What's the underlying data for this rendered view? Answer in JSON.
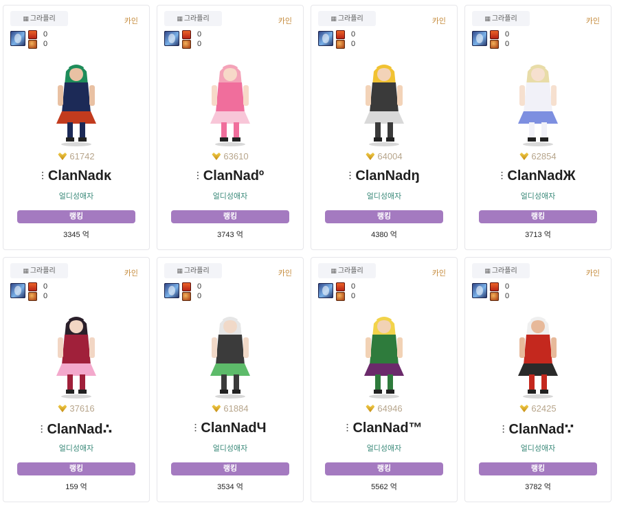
{
  "cards": [
    {
      "server": "그라플리",
      "job": "카인",
      "stat_a": "0",
      "stat_b": "0",
      "score": "61742",
      "name": "ClanNadĸ",
      "guild": "얼디성애자",
      "rank_label": "랭킹",
      "fame": "3345 억",
      "palette": {
        "hair": "#1e8c5a",
        "body": "#1c2a57",
        "accent": "#c23b1e",
        "skin": "#e9c1a3"
      }
    },
    {
      "server": "그라플리",
      "job": "카인",
      "stat_a": "0",
      "stat_b": "0",
      "score": "63610",
      "name": "ClanNadº",
      "guild": "얼디성애자",
      "rank_label": "랭킹",
      "fame": "3743 억",
      "palette": {
        "hair": "#f4a3b8",
        "body": "#f06e9c",
        "accent": "#f8c6d8",
        "skin": "#f7d9c8"
      }
    },
    {
      "server": "그라플리",
      "job": "카인",
      "stat_a": "0",
      "stat_b": "0",
      "score": "64004",
      "name": "ClanNadŋ",
      "guild": "얼디성애자",
      "rank_label": "랭킹",
      "fame": "4380 억",
      "palette": {
        "hair": "#f1c232",
        "body": "#3a3a3a",
        "accent": "#d9d9d9",
        "skin": "#f3d3b8"
      }
    },
    {
      "server": "그라플리",
      "job": "카인",
      "stat_a": "0",
      "stat_b": "0",
      "score": "62854",
      "name": "ClanNadЖ",
      "guild": "얼디성애자",
      "rank_label": "랭킹",
      "fame": "3713 억",
      "palette": {
        "hair": "#e8dca8",
        "body": "#f1f1f8",
        "accent": "#7d8fe0",
        "skin": "#f6e0cf"
      }
    },
    {
      "server": "그라플리",
      "job": "카인",
      "stat_a": "0",
      "stat_b": "0",
      "score": "37616",
      "name": "ClanNad∴",
      "guild": "얼디성애자",
      "rank_label": "랭킹",
      "fame": "159 억",
      "palette": {
        "hair": "#2a1f2a",
        "body": "#a0203a",
        "accent": "#f3a9cc",
        "skin": "#f2d6c4"
      }
    },
    {
      "server": "그라플리",
      "job": "카인",
      "stat_a": "0",
      "stat_b": "0",
      "score": "61884",
      "name": "ClanNadЧ",
      "guild": "얼디성애자",
      "rank_label": "랭킹",
      "fame": "3534 억",
      "palette": {
        "hair": "#e6e6e6",
        "body": "#3b3b3b",
        "accent": "#5dbb6a",
        "skin": "#f1d9c8"
      }
    },
    {
      "server": "그라플리",
      "job": "카인",
      "stat_a": "0",
      "stat_b": "0",
      "score": "64946",
      "name": "ClanNad™",
      "guild": "얼디성애자",
      "rank_label": "랭킹",
      "fame": "5562 억",
      "palette": {
        "hair": "#f2d34a",
        "body": "#2e7b3c",
        "accent": "#6b2a6b",
        "skin": "#f2d2b5"
      }
    },
    {
      "server": "그라플리",
      "job": "카인",
      "stat_a": "0",
      "stat_b": "0",
      "score": "62425",
      "name": "ClanNad∵",
      "guild": "얼디성애자",
      "rank_label": "랭킹",
      "fame": "3782 억",
      "palette": {
        "hair": "#efefef",
        "body": "#c4281e",
        "accent": "#2a2a2a",
        "skin": "#e7b99a"
      }
    }
  ]
}
